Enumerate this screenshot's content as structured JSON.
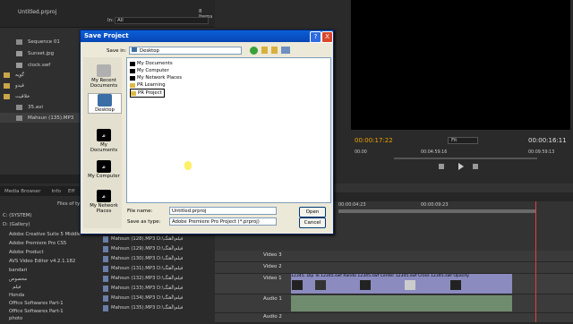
{
  "project": {
    "title": "Untitled.prproj",
    "items_count": "8 Items",
    "in_label": "In:",
    "in_value": "All",
    "items": [
      {
        "label": "Sequence 01"
      },
      {
        "label": "Sunset.jpg"
      },
      {
        "label": "clock.swf"
      },
      {
        "label": "گویه"
      },
      {
        "label": "قیدو"
      },
      {
        "label": "خلاقیت"
      },
      {
        "label": "35.avi"
      },
      {
        "label": "Mahsun (135).MP3"
      }
    ]
  },
  "media_browser": {
    "tabs": [
      "Media Browser",
      "Info",
      "Eff"
    ],
    "files_of_type": "Files of ty",
    "tree": [
      "C: (SYSTEM)",
      "D: (Gallery)",
      "Adobe Creative Suite 5 Middle",
      "Adobe Premiere Pro CS5",
      "Adobe Product",
      "AVS Video Editor v4.2.1.182",
      "bandari",
      "مخصوص",
      "فیلم",
      "Honda",
      "Office Softwares Part-1",
      "Office Softwares Part-1",
      "photo"
    ],
    "files": [
      {
        "name": "Mahsun (128).MP3",
        "path": "D:\\فیلم\\آهنگ"
      },
      {
        "name": "Mahsun (129).MP3",
        "path": "D:\\فیلم\\آهنگ"
      },
      {
        "name": "Mahsun (130).MP3",
        "path": "D:\\فیلم\\آهنگ"
      },
      {
        "name": "Mahsun (131).MP3",
        "path": "D:\\فیلم\\آهنگ"
      },
      {
        "name": "Mahsun (132).MP3",
        "path": "D:\\فیلم\\آهنگ"
      },
      {
        "name": "Mahsun (133).MP3",
        "path": "D:\\فیلم\\آهنگ"
      },
      {
        "name": "Mahsun (134).MP3",
        "path": "D:\\فیلم\\آهنگ"
      },
      {
        "name": "Mahsun (135).MP3",
        "path": "D:\\فیلم\\آهنگ"
      }
    ]
  },
  "monitor": {
    "timecode_left": "00:00:17:22",
    "fit": "Fit",
    "timecode_right": "00:00:16:11",
    "ruler": [
      "00:00",
      "00:04:59:16",
      "00:09:59:13"
    ]
  },
  "timeline": {
    "ruler": [
      "00:00:04:23",
      "00:00:09:23"
    ],
    "tracks": [
      "Video 3",
      "Video 2",
      "Video 1",
      "Audio 1",
      "Audio 2"
    ],
    "clips": [
      "12345.",
      "Dip To",
      "12345.swf",
      "Rando",
      "12345.swf",
      "Center",
      "12345.swf",
      "Cross",
      "12345.swf",
      "Opacity"
    ]
  },
  "dialog": {
    "title": "Save Project",
    "help": "?",
    "close": "X",
    "save_in_label": "Save in:",
    "save_in_value": "Desktop",
    "places": [
      "My Recent Documents",
      "Desktop",
      "My Documents",
      "My Computer",
      "My Network Places"
    ],
    "list": [
      {
        "label": "My Documents"
      },
      {
        "label": "My Computer"
      },
      {
        "label": "My Network Places"
      },
      {
        "label": "PR Learning"
      },
      {
        "label": "PR Project"
      }
    ],
    "file_name_label": "File name:",
    "file_name_value": "Untitled.prproj",
    "save_as_label": "Save as type:",
    "save_as_value": "Adobe Premiere Pro Project (*.prproj)",
    "open_button": "Open",
    "cancel_button": "Cancel"
  },
  "colors": {
    "accent": "#f0a000",
    "title_bar": "#0a5fd7"
  }
}
